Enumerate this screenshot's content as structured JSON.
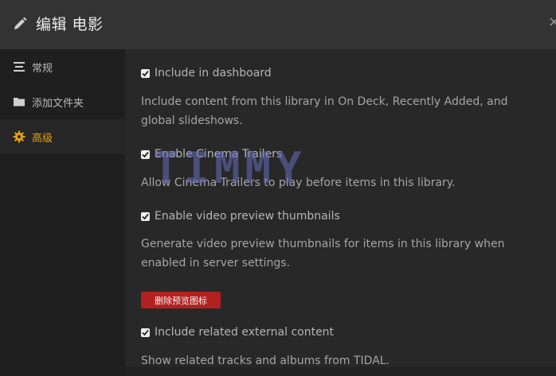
{
  "header": {
    "title": "编辑 电影",
    "close_label": "×"
  },
  "sidebar": {
    "items": [
      {
        "label": "常规",
        "icon": "list-icon",
        "active": false
      },
      {
        "label": "添加文件夹",
        "icon": "folder-icon",
        "active": false
      },
      {
        "label": "高级",
        "icon": "gear-icon",
        "active": true
      }
    ]
  },
  "settings": [
    {
      "label": "Include in dashboard",
      "checked": true,
      "description": "Include content from this library in On Deck, Recently Added, and global slideshows."
    },
    {
      "label": "Enable Cinema Trailers",
      "checked": true,
      "description": "Allow Cinema Trailers to play before items in this library."
    },
    {
      "label": "Enable video preview thumbnails",
      "checked": true,
      "description": "Generate video preview thumbnails for items in this library when enabled in server settings."
    },
    {
      "label": "Include related external content",
      "checked": true,
      "description": "Show related tracks and albums from TIDAL."
    }
  ],
  "delete_button": {
    "label": "删除预览图标"
  },
  "watermark": "TIMMY",
  "colors": {
    "accent": "#e5a00d",
    "danger": "#b32020",
    "sidebar_bg": "#1f1f1f",
    "header_bg": "#333333",
    "content_bg": "#282828"
  }
}
